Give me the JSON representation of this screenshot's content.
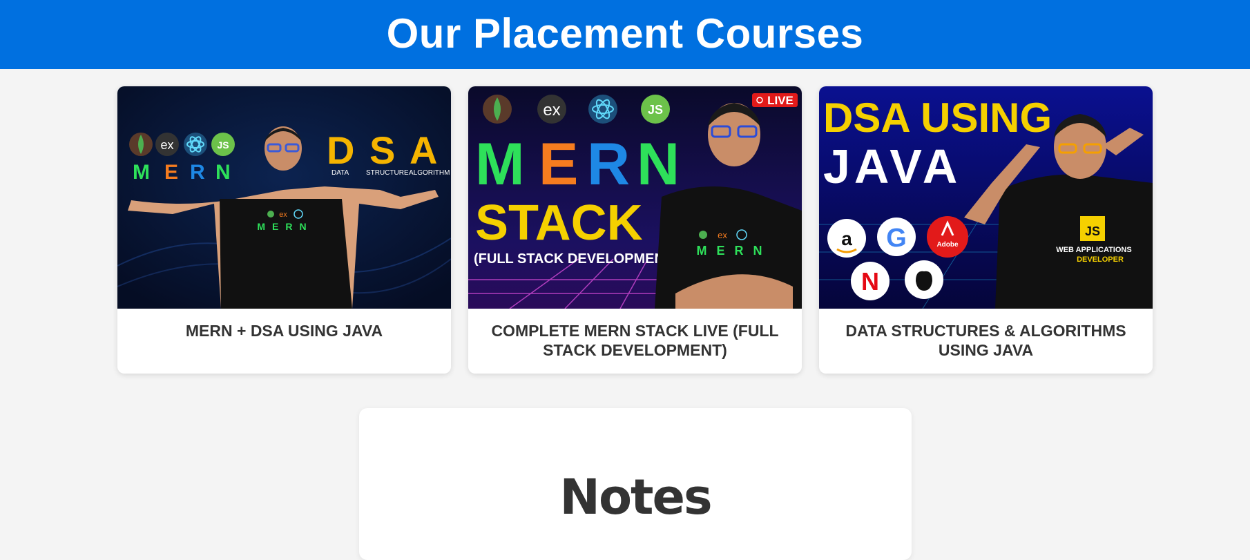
{
  "header": {
    "title": "Our Placement Courses"
  },
  "courses": [
    {
      "title": "MERN + DSA USING JAVA",
      "thumb": {
        "logo_labels": [
          "ex",
          "JS"
        ],
        "word": "MERN",
        "word_letters": [
          "M",
          "E",
          "R",
          "N"
        ],
        "big": "DSA",
        "big_letters": [
          "D",
          "S",
          "A"
        ],
        "sub": [
          "DATA",
          "STRUCTURE",
          "ALGORITHM"
        ],
        "shirt_word": "MERN",
        "shirt_logo": "ex"
      }
    },
    {
      "title": "COMPLETE MERN STACK LIVE (FULL STACK DEVELOPMENT)",
      "thumb": {
        "live": "LIVE",
        "logo_labels": [
          "ex",
          "JS"
        ],
        "word_letters": [
          "M",
          "E",
          "R",
          "N"
        ],
        "stack": "STACK",
        "sub": "(FULL STACK DEVELOPMENT)",
        "shirt_word": "MERN",
        "shirt_logo": "ex"
      }
    },
    {
      "title": "DATA STRUCTURES & ALGORITHMS USING JAVA",
      "thumb": {
        "line1": "DSA USING",
        "line2": "JAVA",
        "brands": [
          "a",
          "G",
          "Adobe",
          "N"
        ],
        "shirt_badge": "JS",
        "shirt_line1": "WEB APPLICATIONS",
        "shirt_line2": "DEVELOPER"
      }
    }
  ],
  "notes": {
    "title": "Notes"
  },
  "colors": {
    "header_bg": "#0070e0",
    "mern_m": "#2ee05a",
    "mern_e": "#f57c1f",
    "mern_r": "#1e88e5",
    "mern_n": "#2ee05a",
    "dsa_yellow": "#f5b400",
    "java_yellow": "#f5d000"
  }
}
